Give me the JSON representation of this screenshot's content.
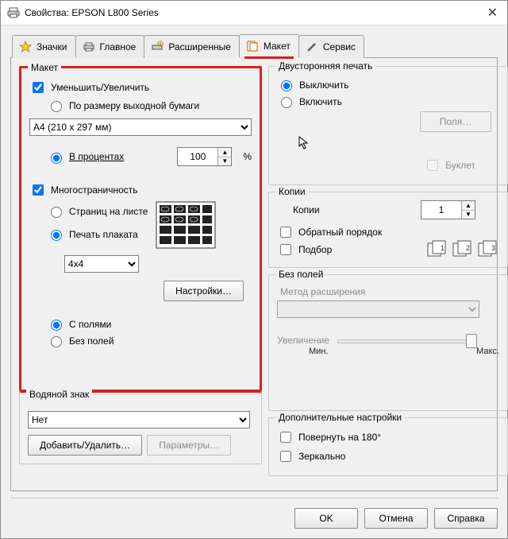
{
  "window": {
    "title": "Свойства: EPSON L800 Series"
  },
  "tabs": {
    "icons_tab": "Значки",
    "main_tab": "Главное",
    "advanced_tab": "Расширенные",
    "layout_tab": "Макет",
    "service_tab": "Сервис"
  },
  "layoutgrp": {
    "title": "Макет",
    "reduce_enlarge": "Уменьшить/Увеличить",
    "by_output_paper": "По размеру выходной бумаги",
    "paper_size": "A4 (210 x 297 мм)",
    "in_percent": "В процентах",
    "percent_value": "100",
    "percent_sign": "%",
    "multipage": "Многостраничность",
    "pages_per_sheet": "Страниц на листе",
    "poster_print": "Печать плаката",
    "poster_size": "4x4",
    "settings_btn": "Настройки…",
    "with_borders": "С полями",
    "borderless": "Без полей"
  },
  "watermark": {
    "title": "Водяной знак",
    "value": "Нет",
    "add_remove": "Добавить/Удалить…",
    "params": "Параметры…"
  },
  "duplex": {
    "title": "Двусторонняя печать",
    "off": "Выключить",
    "on": "Включить",
    "fields_btn": "Поля…",
    "booklet": "Буклет"
  },
  "copies": {
    "title": "Копии",
    "label": "Копии",
    "value": "1",
    "reverse": "Обратный порядок",
    "collate": "Подбор"
  },
  "borderlessgrp": {
    "title": "Без полей",
    "method_label": "Метод расширения",
    "enlargement_label": "Увеличение",
    "min": "Мин.",
    "max": "Макс."
  },
  "extra": {
    "title": "Дополнительные настройки",
    "rotate": "Повернуть на  180°",
    "mirror": "Зеркально"
  },
  "buttons": {
    "ok": "OK",
    "cancel": "Отмена",
    "help": "Справка"
  }
}
